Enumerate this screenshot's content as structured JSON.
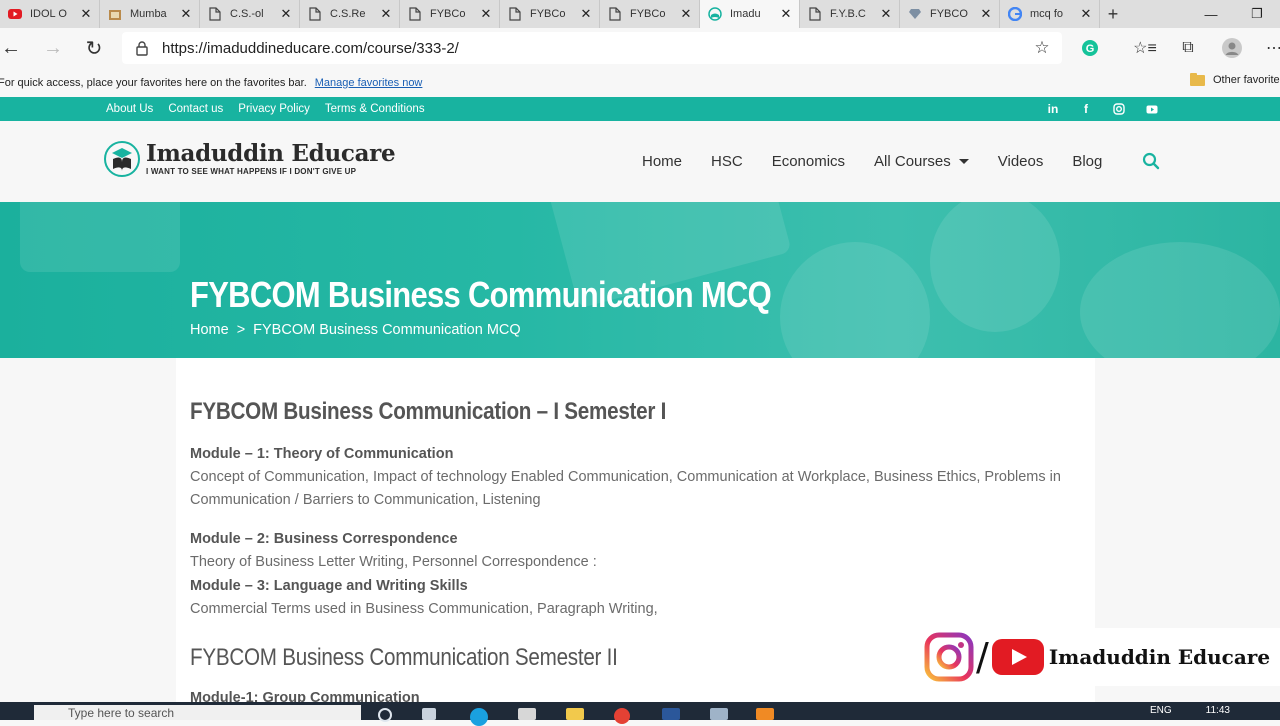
{
  "browser": {
    "tabs": [
      {
        "title": "IDOL O",
        "icon": "youtube-icon",
        "active": false
      },
      {
        "title": "Mumba",
        "icon": "university-icon",
        "active": false
      },
      {
        "title": "C.S.-ol",
        "icon": "page-icon",
        "active": false
      },
      {
        "title": "C.S.Re",
        "icon": "page-icon",
        "active": false
      },
      {
        "title": "FYBCo",
        "icon": "page-icon",
        "active": false
      },
      {
        "title": "FYBCo",
        "icon": "page-icon",
        "active": false
      },
      {
        "title": "FYBCo",
        "icon": "page-icon",
        "active": false
      },
      {
        "title": "Imadu",
        "icon": "site-icon",
        "active": true
      },
      {
        "title": "F.Y.B.C",
        "icon": "page-icon",
        "active": false
      },
      {
        "title": "FYBCO",
        "icon": "gem-icon",
        "active": false
      },
      {
        "title": "mcq fo",
        "icon": "google-icon",
        "active": false
      }
    ],
    "url": "https://imaduddineducare.com/course/333-2/",
    "favorites_hint": "For quick access, place your favorites here on the favorites bar.",
    "manage_favorites": "Manage favorites now",
    "other_favorites": "Other favorites"
  },
  "site": {
    "top_links": [
      "About Us",
      "Contact us",
      "Privacy Policy",
      "Terms & Conditions"
    ],
    "social": [
      "linkedin-icon",
      "facebook-icon",
      "instagram-icon",
      "youtube-icon"
    ],
    "logo_name": "Imaduddin Educare",
    "logo_tagline": "I WANT TO SEE WHAT HAPPENS IF I DON'T GIVE UP",
    "nav": [
      {
        "label": "Home"
      },
      {
        "label": "HSC"
      },
      {
        "label": "Economics"
      },
      {
        "label": "All Courses",
        "dropdown": true
      },
      {
        "label": "Videos"
      },
      {
        "label": "Blog"
      }
    ],
    "accent_color": "#18b3a0"
  },
  "hero": {
    "title": "FYBCOM Business Communication MCQ",
    "breadcrumb_home": "Home",
    "breadcrumb_sep": ">",
    "breadcrumb_current": "FYBCOM Business Communication MCQ"
  },
  "content": {
    "sem1_heading": "FYBCOM Business Communication – I Semester I",
    "m1_title": "Module – 1: Theory of Communication",
    "m1_desc": "Concept of Communication, Impact of technology Enabled Communication, Communication at Workplace, Business Ethics, Problems in Communication / Barriers to Communication, Listening",
    "m2_title": "Module – 2: Business Correspondence",
    "m2_desc": "Theory of Business Letter Writing, Personnel Correspondence :",
    "m3_title": "Module – 3: Language and Writing Skills",
    "m3_desc": "Commercial Terms used in Business Communication, Paragraph Writing,",
    "sem2_heading": "FYBCOM Business Communication Semester II",
    "sem2_m1_title": "Module-1: Group Communication"
  },
  "overlay": {
    "slash": "/",
    "brand": "Imaduddin Educare"
  },
  "taskbar": {
    "search_placeholder": "Type here to search",
    "lang": "ENG",
    "time": "11:43"
  }
}
